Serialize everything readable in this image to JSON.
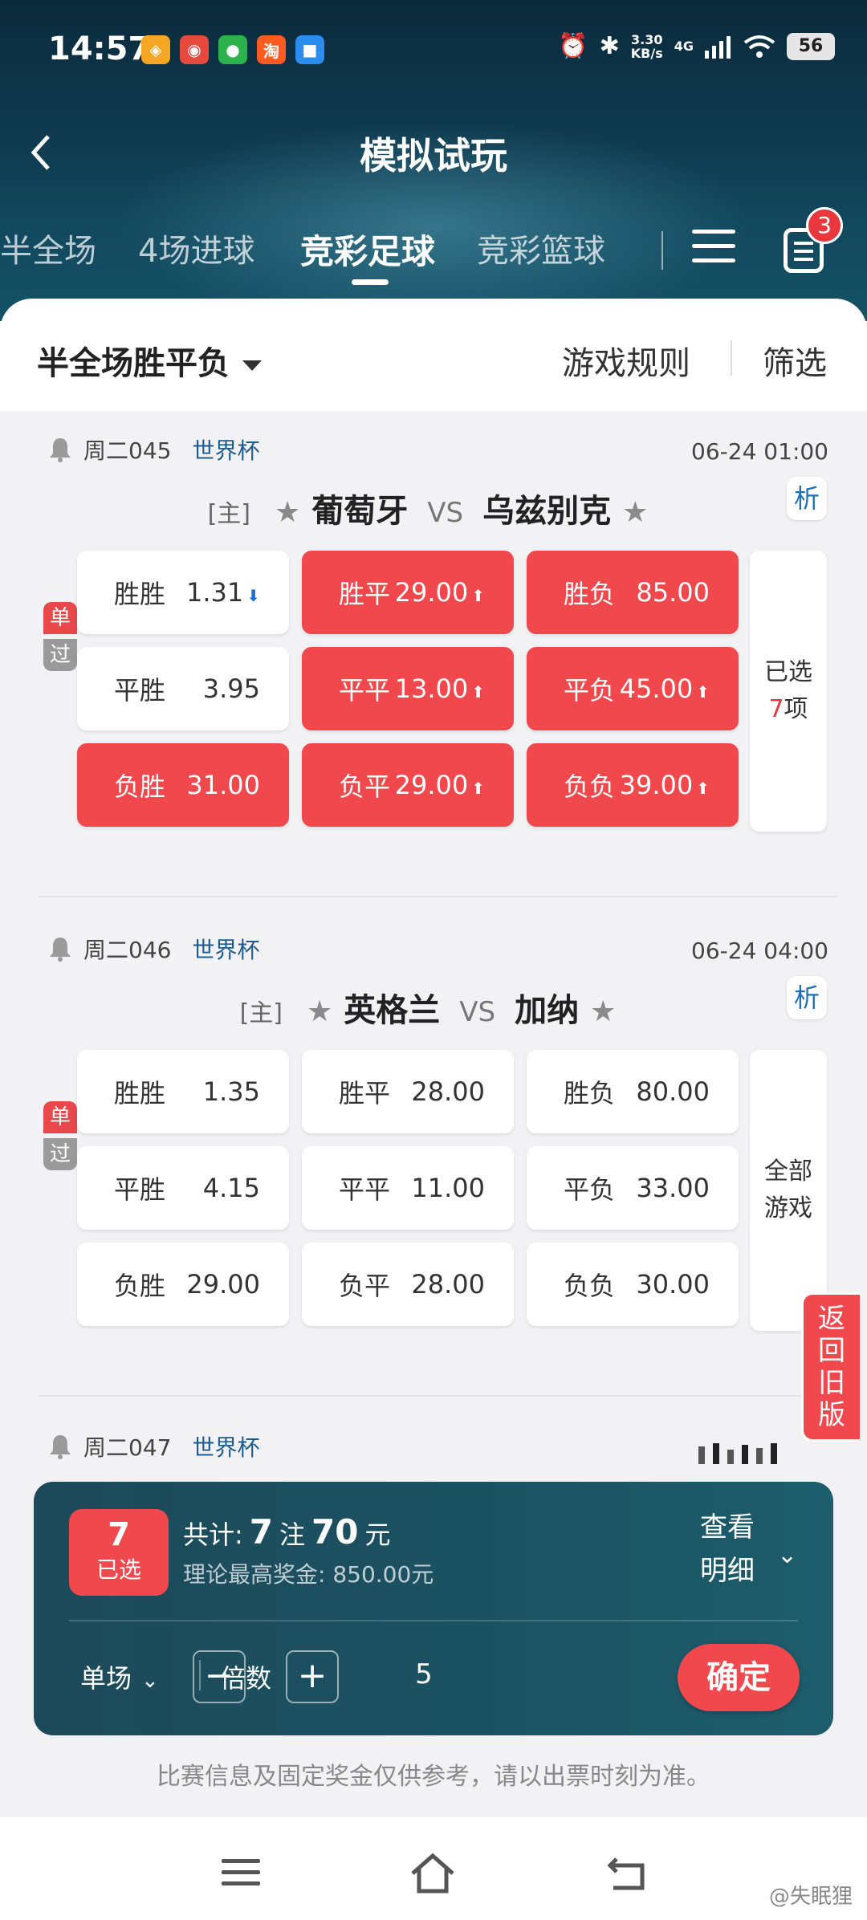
{
  "status_bar": {
    "time": "14:57",
    "net_speed_value": "3.30",
    "net_speed_unit": "KB/s",
    "network": "4G",
    "battery": "56"
  },
  "app_icons": [
    "mint-app",
    "weibo",
    "wechat",
    "taobao",
    "blue-app"
  ],
  "header": {
    "title": "模拟试玩"
  },
  "tabs": [
    {
      "label": "半全场",
      "active": false
    },
    {
      "label": "4场进球",
      "active": false
    },
    {
      "label": "竞彩足球",
      "active": true
    },
    {
      "label": "竞彩篮球",
      "active": false
    }
  ],
  "cart_badge": "3",
  "filter_bar": {
    "play_type": "半全场胜平负",
    "rules": "游戏规则",
    "filter": "筛选"
  },
  "single_tag": {
    "top": "单",
    "bottom": "过"
  },
  "host_tag": "[主]",
  "vs": "VS",
  "analysis_label": "析",
  "matches": [
    {
      "code": "周二045",
      "league": "世界杯",
      "time": "06-24 01:00",
      "home": "葡萄牙",
      "away": "乌兹别克",
      "odds": [
        {
          "label": "胜胜",
          "value": "1.31",
          "selected": false,
          "trend": "down"
        },
        {
          "label": "胜平",
          "value": "29.00",
          "selected": true,
          "trend": "up"
        },
        {
          "label": "胜负",
          "value": "85.00",
          "selected": true,
          "trend": ""
        },
        {
          "label": "平胜",
          "value": "3.95",
          "selected": false,
          "trend": ""
        },
        {
          "label": "平平",
          "value": "13.00",
          "selected": true,
          "trend": "up"
        },
        {
          "label": "平负",
          "value": "45.00",
          "selected": true,
          "trend": "up"
        },
        {
          "label": "负胜",
          "value": "31.00",
          "selected": true,
          "trend": ""
        },
        {
          "label": "负平",
          "value": "29.00",
          "selected": true,
          "trend": "up"
        },
        {
          "label": "负负",
          "value": "39.00",
          "selected": true,
          "trend": "up"
        }
      ],
      "side": {
        "line1": "已选",
        "count": "7",
        "suffix": "项"
      }
    },
    {
      "code": "周二046",
      "league": "世界杯",
      "time": "06-24 04:00",
      "home": "英格兰",
      "away": "加纳",
      "odds": [
        {
          "label": "胜胜",
          "value": "1.35",
          "selected": false,
          "trend": ""
        },
        {
          "label": "胜平",
          "value": "28.00",
          "selected": false,
          "trend": ""
        },
        {
          "label": "胜负",
          "value": "80.00",
          "selected": false,
          "trend": ""
        },
        {
          "label": "平胜",
          "value": "4.15",
          "selected": false,
          "trend": ""
        },
        {
          "label": "平平",
          "value": "11.00",
          "selected": false,
          "trend": ""
        },
        {
          "label": "平负",
          "value": "33.00",
          "selected": false,
          "trend": ""
        },
        {
          "label": "负胜",
          "value": "29.00",
          "selected": false,
          "trend": ""
        },
        {
          "label": "负平",
          "value": "28.00",
          "selected": false,
          "trend": ""
        },
        {
          "label": "负负",
          "value": "30.00",
          "selected": false,
          "trend": ""
        }
      ],
      "side": {
        "line1": "全部",
        "line2": "游戏"
      }
    }
  ],
  "next_match": {
    "code": "周二047",
    "league": "世界杯"
  },
  "old_version": [
    "返",
    "回",
    "旧",
    "版"
  ],
  "bet_bar": {
    "selected_count": "7",
    "selected_label": "已选",
    "total_prefix": "共计:",
    "bets": "7",
    "bets_unit": "注",
    "amount": "70",
    "amount_unit": "元",
    "max_prize": "理论最高奖金: 850.00元",
    "detail_line1": "查看",
    "detail_line2": "明细",
    "mode": "单场",
    "multiplier_label": "倍数",
    "minus": "−",
    "multiplier": "5",
    "plus": "+",
    "confirm": "确定"
  },
  "disclaimer": "比赛信息及固定奖金仅供参考，请以出票时刻为准。",
  "watermark": "@失眠狸",
  "colors": {
    "accent_red": "#f0484c",
    "header_dark": "#0f3b50",
    "bet_bar": "#1b5363"
  }
}
